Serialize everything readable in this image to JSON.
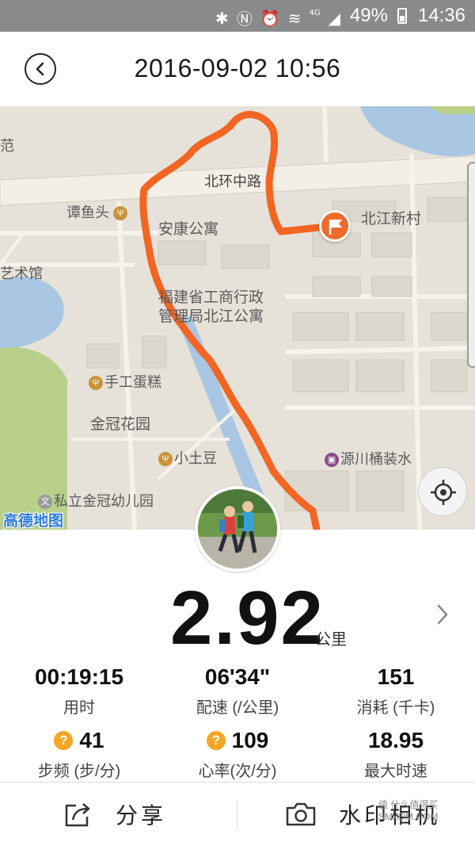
{
  "status_bar": {
    "battery": "49%",
    "time": "14:36",
    "network": "4G"
  },
  "header": {
    "title": "2016-09-02 10:56"
  },
  "map": {
    "labels": {
      "road": "北环中路",
      "tanyutou": "谭鱼头",
      "ankang": "安康公寓",
      "beijiang": "北江新村",
      "yishuguan": "艺术馆",
      "fujian_line1": "福建省工商行政",
      "fujian_line2": "管理局北江公寓",
      "shougong": "手工蛋糕",
      "jinguan": "金冠花园",
      "xiaotudou": "小土豆",
      "yuanchuan": "源川桶装水",
      "kindergarten": "私立金冠幼儿园",
      "edge_left": "范"
    },
    "logo": "高德地图",
    "colors": {
      "route": "#f26522",
      "water": "#a9c6e3",
      "green": "#b8d08a"
    }
  },
  "summary": {
    "distance": "2.92",
    "distance_unit": "公里"
  },
  "stats": [
    {
      "value": "00:19:15",
      "label": "用时",
      "help": false
    },
    {
      "value": "06'34\"",
      "label": "配速 (/公里)",
      "help": false
    },
    {
      "value": "151",
      "label": "消耗 (千卡)",
      "help": false
    },
    {
      "value": "41",
      "label": "步频 (步/分)",
      "help": true
    },
    {
      "value": "109",
      "label": "心率(次/分)",
      "help": true
    },
    {
      "value": "18.95",
      "label": "最大时速",
      "help": false
    }
  ],
  "bottom_bar": {
    "share_label": "分享",
    "camera_label": "水印相机"
  },
  "watermark": "值 什么值得买 SMZDM.COM"
}
